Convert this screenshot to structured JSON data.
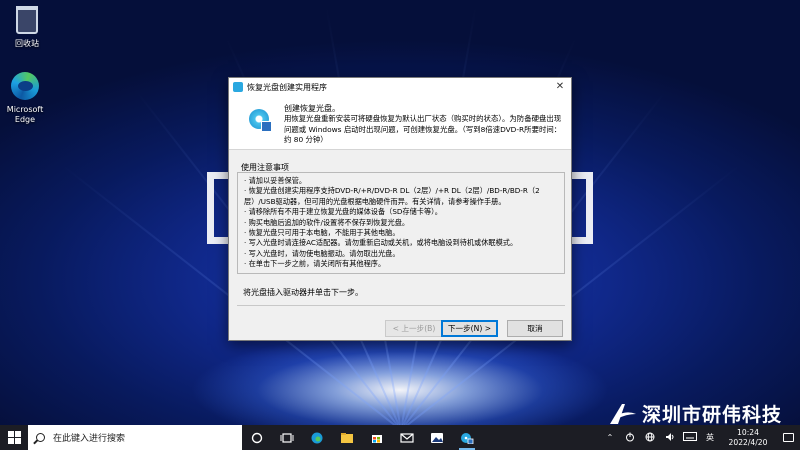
{
  "desktop": {
    "icons": [
      {
        "label": "回收站",
        "icon": "recycle-bin-icon"
      },
      {
        "label": "Microsoft Edge",
        "icon": "edge-icon"
      }
    ],
    "watermark": "深圳市研伟科技"
  },
  "dialog": {
    "title": "恢复光盘创建实用程序",
    "heading": "创建恢复光盘。",
    "description": "用恢复光盘重新安装可将硬盘恢复为默认出厂状态（购买时的状态）。为防备硬盘出现问题或 Windows 启动时出现问题，可创建恢复光盘。（写到8倍速DVD-R所要时间：约 80 分钟）",
    "notes_label": "使用注意事项",
    "notes": [
      "· 请加以妥善保管。",
      "· 恢复光盘创建实用程序支持DVD-R/+R/DVD-R DL（2层）/+R DL（2层）/BD-R/BD-R（2层）/USB驱动器，但可用的光盘根据电脑硬件而异。有关详情，请参考操作手册。",
      "· 请移除所有不用于建立恢复光盘的媒体设备（SD存储卡等）。",
      "· 购买电脑后追加的软件/设置将不保存到恢复光盘。",
      "· 恢复光盘只可用于本电脑，不能用于其他电脑。",
      "· 写入光盘时请连接AC适配器。请勿重新启动或关机，或将电脑设到待机或休眠模式。",
      "· 写入光盘时，请勿使电脑振动。请勿取出光盘。",
      "· 在单击下一步之前，请关闭所有其他程序。"
    ],
    "instruction": "将光盘插入驱动器并单击下一步。",
    "buttons": {
      "back": "< 上一步(B)",
      "next": "下一步(N) >",
      "cancel": "取消"
    }
  },
  "taskbar": {
    "search_placeholder": "在此键入进行搜索",
    "pinned": [
      "start-icon",
      "search-icon",
      "cortana-icon",
      "task-view-icon",
      "edge-icon",
      "file-explorer-icon",
      "store-icon",
      "mail-icon",
      "photos-icon",
      "recovery-disc-icon"
    ],
    "tray": {
      "ime": "英",
      "time": "10:24",
      "date": "2022/4/20"
    }
  },
  "colors": {
    "accent": "#0078d7",
    "taskbar": "#1c1d24",
    "dialog_bg": "#f0f0f0"
  }
}
